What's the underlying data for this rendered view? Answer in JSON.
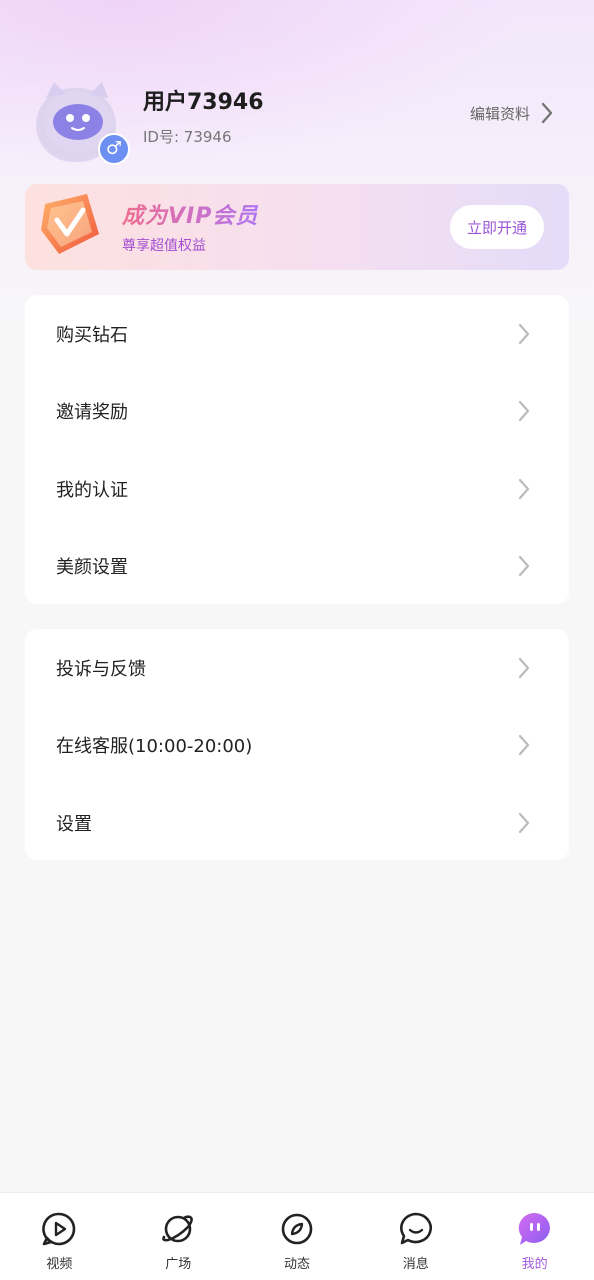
{
  "profile": {
    "username": "用户73946",
    "id_text": "ID号: 73946",
    "edit_label": "编辑资料",
    "gender_symbol": "♂"
  },
  "vip": {
    "title": "成为VIP会员",
    "subtitle": "尊享超值权益",
    "button_label": "立即开通"
  },
  "menu_group_1": [
    {
      "label": "购买钻石"
    },
    {
      "label": "邀请奖励"
    },
    {
      "label": "我的认证"
    },
    {
      "label": "美颜设置"
    }
  ],
  "menu_group_2": [
    {
      "label": "投诉与反馈"
    },
    {
      "label": "在线客服(10:00-20:00)"
    },
    {
      "label": "设置"
    }
  ],
  "nav": {
    "items": [
      {
        "label": "视频",
        "icon": "video-play-icon"
      },
      {
        "label": "广场",
        "icon": "planet-icon"
      },
      {
        "label": "动态",
        "icon": "compass-icon"
      },
      {
        "label": "消息",
        "icon": "chat-bubble-icon"
      },
      {
        "label": "我的",
        "icon": "me-icon"
      }
    ],
    "active_index": 4,
    "active_color": "#a35ae0"
  },
  "colors": {
    "accent": "#a35ae0",
    "gender_badge": "#6d8ff2"
  }
}
